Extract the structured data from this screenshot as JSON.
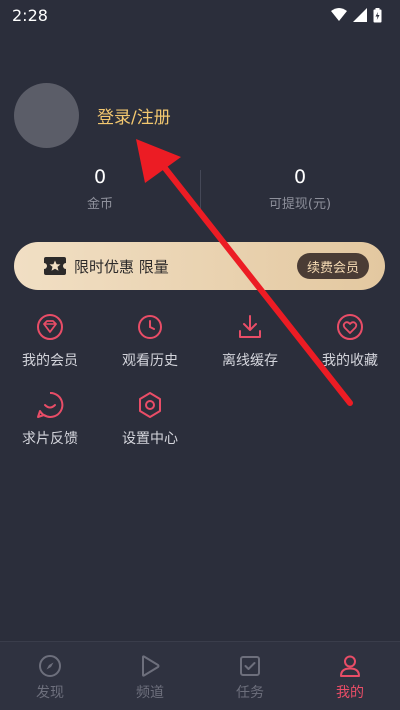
{
  "status_bar": {
    "time": "2:28"
  },
  "profile": {
    "login_label": "登录/注册"
  },
  "stats": [
    {
      "value": "0",
      "label": "金币"
    },
    {
      "value": "0",
      "label": "可提现(元)"
    }
  ],
  "vip_banner": {
    "text": "限时优惠 限量",
    "button": "续费会员"
  },
  "features": [
    {
      "label": "我的会员",
      "icon": "diamond-icon"
    },
    {
      "label": "观看历史",
      "icon": "clock-icon"
    },
    {
      "label": "离线缓存",
      "icon": "download-icon"
    },
    {
      "label": "我的收藏",
      "icon": "heart-icon"
    },
    {
      "label": "求片反馈",
      "icon": "feedback-icon"
    },
    {
      "label": "设置中心",
      "icon": "settings-icon"
    }
  ],
  "tabbar": [
    {
      "label": "发现",
      "icon": "compass-icon",
      "active": false
    },
    {
      "label": "频道",
      "icon": "play-icon",
      "active": false
    },
    {
      "label": "任务",
      "icon": "task-icon",
      "active": false
    },
    {
      "label": "我的",
      "icon": "profile-icon",
      "active": true
    }
  ],
  "colors": {
    "background": "#2b2e3b",
    "accent_gold": "#f2c76f",
    "accent_red": "#e94d67",
    "annotation_arrow": "#ec1c24"
  }
}
